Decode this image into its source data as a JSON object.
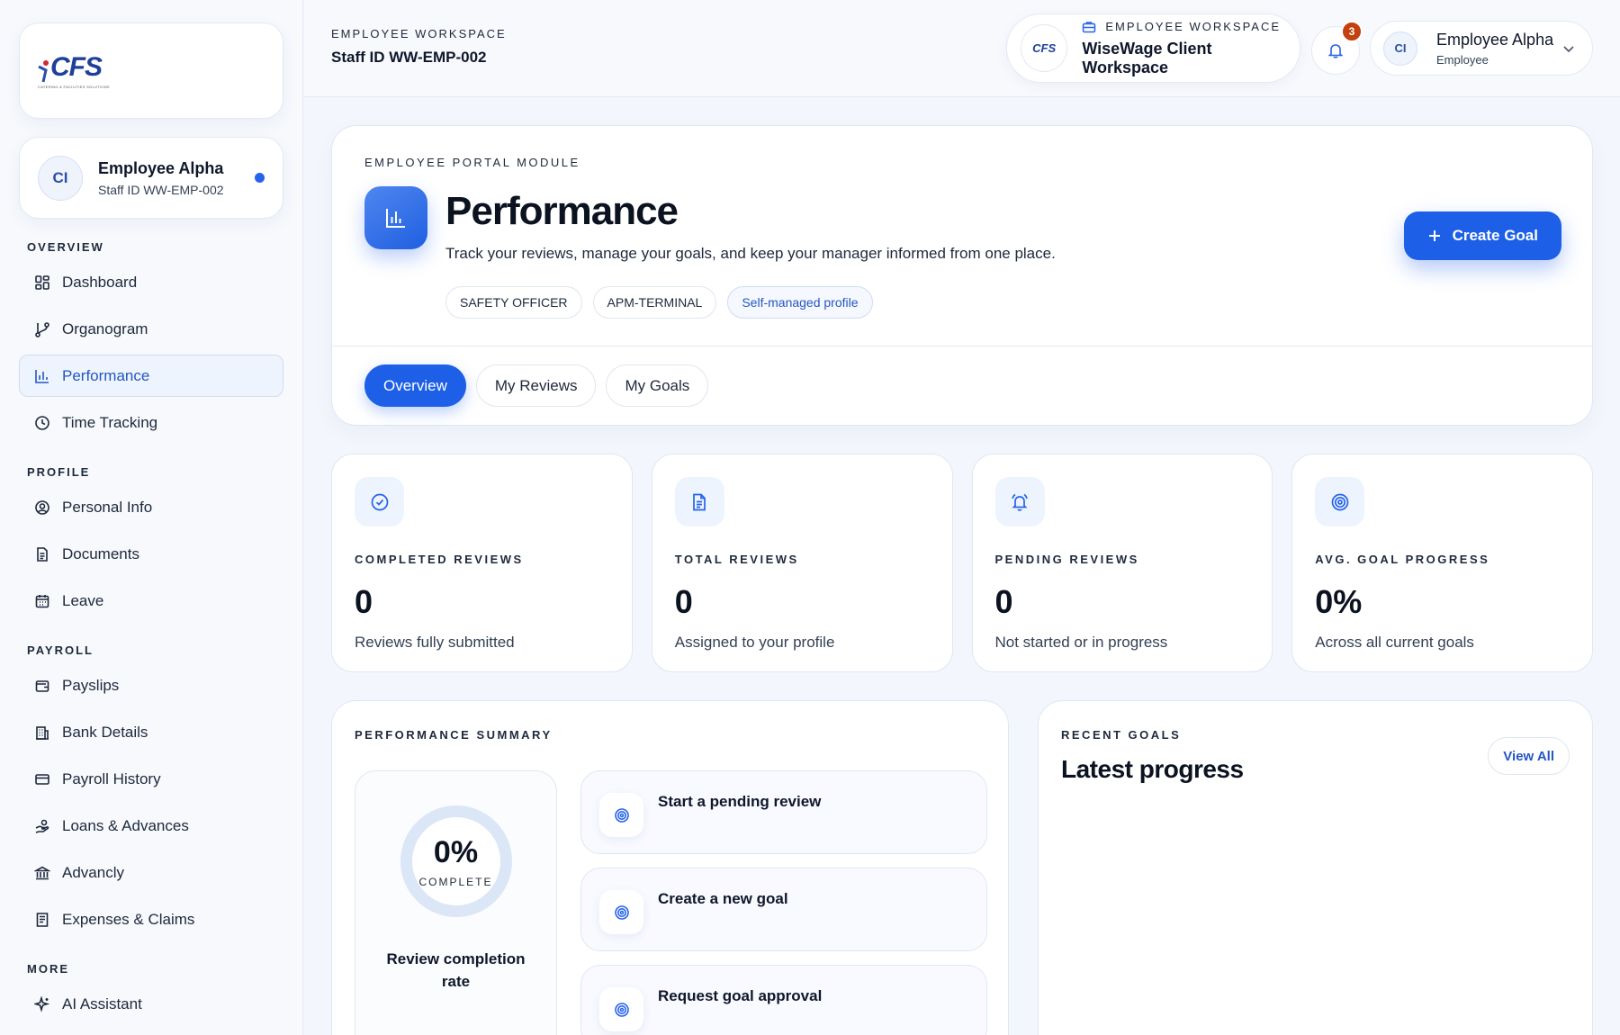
{
  "brand": {
    "logo_text": "CFS",
    "logo_sub": "CATERING & FACILITIES SOLUTIONS"
  },
  "sidebar": {
    "profile": {
      "initials": "CI",
      "name": "Employee Alpha",
      "staff_id": "Staff ID WW-EMP-002"
    },
    "sections": {
      "overview": "OVERVIEW",
      "profile": "PROFILE",
      "payroll": "PAYROLL",
      "more": "MORE"
    },
    "items": {
      "dashboard": "Dashboard",
      "organogram": "Organogram",
      "performance": "Performance",
      "time_tracking": "Time Tracking",
      "personal_info": "Personal Info",
      "documents": "Documents",
      "leave": "Leave",
      "payslips": "Payslips",
      "bank_details": "Bank Details",
      "payroll_history": "Payroll History",
      "loans": "Loans & Advances",
      "advancly": "Advancly",
      "expenses": "Expenses & Claims",
      "ai_assistant": "AI Assistant"
    }
  },
  "topbar": {
    "eyebrow": "EMPLOYEE WORKSPACE",
    "staff_id": "Staff ID WW-EMP-002",
    "workspace": {
      "logo_text": "CFS",
      "eyebrow": "EMPLOYEE WORKSPACE",
      "name": "WiseWage Client Workspace"
    },
    "notifications": "3",
    "user": {
      "initials": "CI",
      "name": "Employee Alpha",
      "role": "Employee"
    }
  },
  "hero": {
    "eyebrow": "EMPLOYEE PORTAL MODULE",
    "title": "Performance",
    "description": "Track your reviews, manage your goals, and keep your manager informed from one place.",
    "chips": [
      "SAFETY OFFICER",
      "APM-TERMINAL",
      "Self-managed profile"
    ],
    "create_label": "Create Goal",
    "tabs": [
      "Overview",
      "My Reviews",
      "My Goals"
    ]
  },
  "stats": [
    {
      "label": "COMPLETED REVIEWS",
      "value": "0",
      "sub": "Reviews fully submitted"
    },
    {
      "label": "TOTAL REVIEWS",
      "value": "0",
      "sub": "Assigned to your profile"
    },
    {
      "label": "PENDING REVIEWS",
      "value": "0",
      "sub": "Not started or in progress"
    },
    {
      "label": "AVG. GOAL PROGRESS",
      "value": "0%",
      "sub": "Across all current goals"
    }
  ],
  "summary": {
    "eyebrow": "PERFORMANCE SUMMARY",
    "rate_value": "0%",
    "rate_caption": "COMPLETE",
    "rate_label": "Review completion rate",
    "actions": [
      "Start a pending review",
      "Create a new goal",
      "Request goal approval"
    ]
  },
  "recent": {
    "eyebrow": "RECENT GOALS",
    "title": "Latest progress",
    "view_all": "View All"
  },
  "colors": {
    "accent": "#1d5fe6",
    "badge": "#c2410c",
    "background": "#f3f6fc"
  }
}
